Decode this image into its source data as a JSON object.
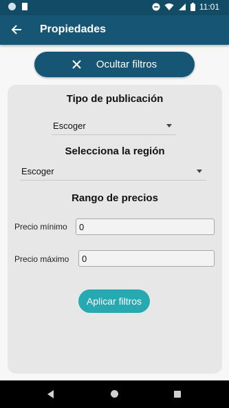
{
  "status_bar": {
    "time": "11:01",
    "icons": [
      "notification-dot-icon",
      "sd-card-icon",
      "dnd-icon",
      "wifi-icon",
      "signal-icon",
      "battery-icon"
    ]
  },
  "app_bar": {
    "title": "Propiedades",
    "back_icon": "arrow-left-icon"
  },
  "hide_filters_button": {
    "icon": "close-icon",
    "label": "Ocultar filtros"
  },
  "filters": {
    "publication_type": {
      "title": "Tipo de publicación",
      "selected": "Escoger"
    },
    "region": {
      "title": "Selecciona la región",
      "selected": "Escoger"
    },
    "price_range": {
      "title": "Rango de precios",
      "min_label": "Precio mínimo",
      "min_value": "0",
      "max_label": "Precio máximo",
      "max_value": "0"
    },
    "apply_label": "Aplicar filtros"
  },
  "colors": {
    "primary": "#175574",
    "status_bar": "#124b66",
    "accent": "#27a9b2",
    "card": "#e7e7e7"
  }
}
